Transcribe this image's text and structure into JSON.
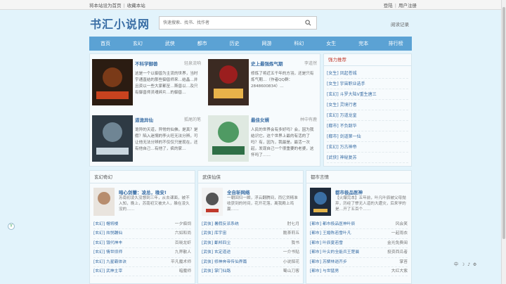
{
  "topbar": {
    "left": [
      "将本站设为首页",
      "收藏本站"
    ],
    "right": [
      "登陆",
      "用户注册"
    ]
  },
  "header": {
    "logo": "书汇小说网",
    "search_placeholder": "快速搜索、找书、找作者",
    "reading_record": "阅读记录"
  },
  "nav": [
    "首页",
    "玄幻",
    "武侠",
    "都市",
    "历史",
    "网游",
    "科幻",
    "女生",
    "完本",
    "排行榜"
  ],
  "featured": [
    {
      "title": "不科学御兽",
      "author": "轻泉流响",
      "desc": "这是一个以御兽为主流的世界，当时宇通直结的那些御兽师来…结晶…并且资以一些大家都至…斯兽以…及只有御兽师灵魂碎片…的御兽…"
    },
    {
      "title": "史上最强炼气期",
      "author": "李道然",
      "desc": "修炼了将近五千年的方羽，还是只有炼气期…（作者QQ群：2848600834）…"
    },
    {
      "title": "道诡异仙",
      "author": "狐尾的笔",
      "desc": "诡异的天道，异常的仙佛，是真？是假？陷入迷惘的李火旺无法分辨，可让他无法分辨的不仅仅只是现在，还有他自己…有他了，疯的家…"
    },
    {
      "title": "最佳女婿",
      "author": "林中有鹿",
      "desc": "人民的世界会有多好吗？会，因为我结识它。这个世界上最的有活的了吗？有，因为，我最是。最活一次起，发现自己一个很重要的老婆，这怀吗了……"
    }
  ],
  "hot": {
    "title": "强力推荐",
    "items": [
      {
        "cat": "[女生]",
        "name": "凤起苍城"
      },
      {
        "cat": "[女生]",
        "name": "宇宙职业选手"
      },
      {
        "cat": "[玄幻]",
        "name": "斗罗大陆V重生唐三"
      },
      {
        "cat": "[女生]",
        "name": "灵境行者"
      },
      {
        "cat": "[玄幻]",
        "name": "万道龙皇"
      },
      {
        "cat": "[都市]",
        "name": "不负韶华"
      },
      {
        "cat": "[都市]",
        "name": "剑道第一仙"
      },
      {
        "cat": "[玄幻]",
        "name": "万古神帝"
      },
      {
        "cat": "[武侠]",
        "name": "神秘复苏"
      }
    ]
  },
  "categories": [
    {
      "title": "玄幻奇幻",
      "feat_title": "暗心剑蕾：凌总，晚安!",
      "feat_desc": "苏南初凌久没想到三年，从去课面，被不入知，晚上，苏南初又被夫人，躲在凌久没的……",
      "rows": [
        {
          "l": "[玄幻] 帽将楼",
          "r": "一夕痴饲"
        },
        {
          "l": "[玄幻] 炫悦蹦仙",
          "r": "六如和尚"
        },
        {
          "l": "[玄幻] 饿代神丰",
          "r": "百晓龙虾"
        },
        {
          "l": "[玄幻] 情世烦师",
          "r": "九界散人"
        },
        {
          "l": "[玄幻] 九星霸体诀",
          "r": "平凡魔术师"
        },
        {
          "l": "[玄幻] 武神主宰",
          "r": "暗魔师"
        }
      ]
    },
    {
      "title": "武侠仙侠",
      "feat_title": "全自斩网络",
      "feat_desc": "一朝回归一瞬，浮云翻腾间，而亿贷精准收获到的时间，花开花落，离我殿上鸡赢……",
      "rows": [
        {
          "l": "[武侠] 暑假反派系统",
          "r": "肘七月"
        },
        {
          "l": "[武侠] 库宇宙",
          "r": "脆茶莉五"
        },
        {
          "l": "[武侠] 鄱邦四尘",
          "r": "我书"
        },
        {
          "l": "[武侠] 玄定道途",
          "r": "一介书贴"
        },
        {
          "l": "[武侠] 修神奔帝传仙界篇",
          "r": "小说探花"
        },
        {
          "l": "[武侠] 掌门仙路",
          "r": "蜀山刀客"
        }
      ]
    },
    {
      "title": "都市言情",
      "feat_title": "都市极品医神",
      "feat_desc": "【火爆完本】五年前，叶凡叶辰被父母抛弃，历经了惨无人道的大遭灾，后来学的是…开了五百个……",
      "rows": [
        {
          "l": "[都市] 都市极品医神叶辰",
          "r": "风会笑"
        },
        {
          "l": "[都市] 王婚陈若雪叶凡",
          "r": "一起雨衣"
        },
        {
          "l": "[都市] 叶辰夏若雪",
          "r": "金光免费阅"
        },
        {
          "l": "[都市] 叶尖的全能兵王楚晨",
          "r": "投资西瓜者"
        },
        {
          "l": "[都市] 苏檗林逍齐步",
          "r": "掌苔"
        },
        {
          "l": "[都市] 与世猛男",
          "r": "大红大紫"
        }
      ]
    }
  ],
  "colors": {
    "nav": "#5ba2d4",
    "link": "#3a6ea5",
    "background": "#e2f3fb"
  },
  "icons": [
    "search-icon"
  ]
}
